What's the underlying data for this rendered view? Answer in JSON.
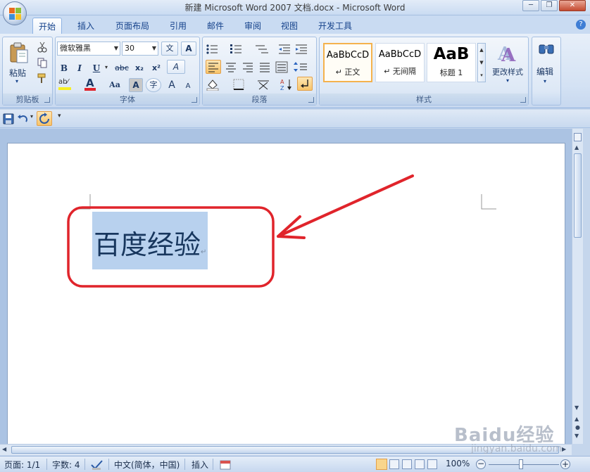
{
  "window": {
    "title": "新建 Microsoft Word 2007 文档.docx - Microsoft Word",
    "minimize": "─",
    "restore": "❐",
    "close": "✕"
  },
  "tabs": [
    {
      "label": "开始",
      "active": true
    },
    {
      "label": "插入"
    },
    {
      "label": "页面布局"
    },
    {
      "label": "引用"
    },
    {
      "label": "邮件"
    },
    {
      "label": "审阅"
    },
    {
      "label": "视图"
    },
    {
      "label": "开发工具"
    }
  ],
  "help": "?",
  "clipboard": {
    "paste_label": "粘贴",
    "group_label": "剪贴板"
  },
  "font": {
    "font_name": "微软雅黑",
    "font_size": "30",
    "bold": "B",
    "italic": "I",
    "underline": "U",
    "strike": "abc",
    "subscript": "x₂",
    "superscript": "x²",
    "change_case": "Aa",
    "grow": "A",
    "shrink": "A",
    "char_border": "A",
    "enclose": "字",
    "phonetic": "文",
    "clear": "A",
    "group_label": "字体"
  },
  "paragraph": {
    "group_label": "段落"
  },
  "styles": {
    "items": [
      {
        "sample": "AaBbCcD",
        "name": "↵ 正文",
        "selected": true
      },
      {
        "sample": "AaBbCcD",
        "name": "↵ 无间隔"
      },
      {
        "sample": "AaB",
        "name": "标题 1"
      }
    ],
    "change_styles": "更改样式",
    "group_label": "样式"
  },
  "editing": {
    "label": "编辑"
  },
  "document": {
    "text": "百度经验",
    "paragraph_mark": "↵"
  },
  "status": {
    "page": "页面: 1/1",
    "words": "字数: 4",
    "language": "中文(简体，中国)",
    "mode": "插入",
    "zoom": "100%"
  },
  "watermark": {
    "brand": "Baidu经验",
    "url": "jingyan.baidu.com"
  },
  "colors": {
    "annotation_red": "#e0242b",
    "selection": "#b8d1ee",
    "accent": "#15428b"
  }
}
